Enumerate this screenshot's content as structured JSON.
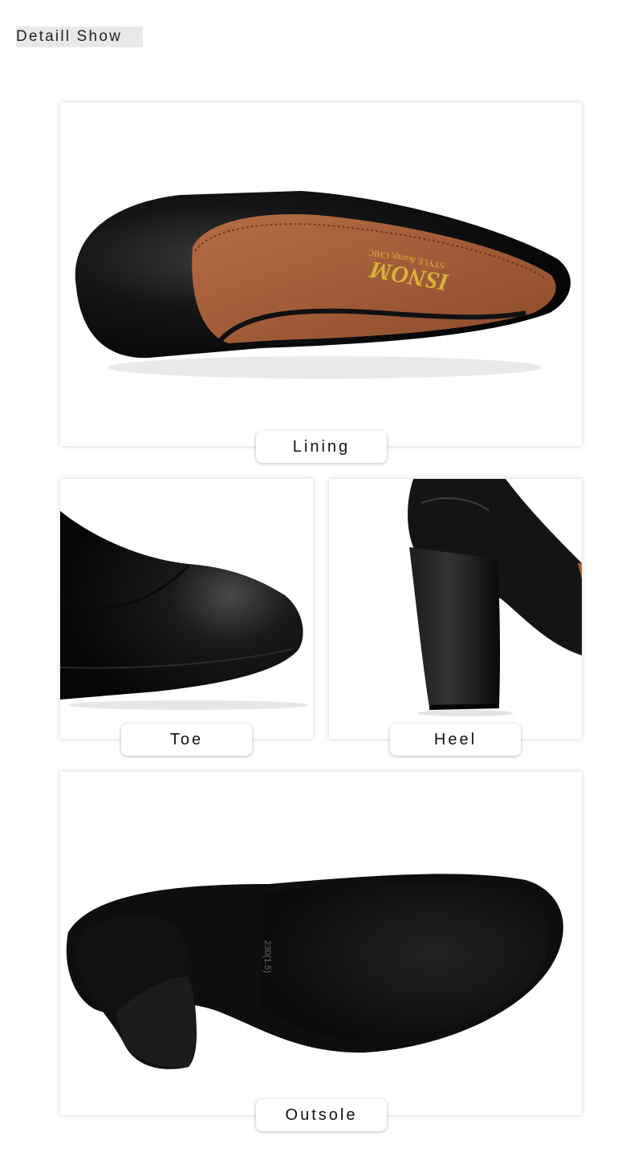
{
  "header": {
    "title": "Detaill Show"
  },
  "sections": {
    "lining": {
      "label": "Lining",
      "logo_text": "ISNOM",
      "logo_sub": "STYLE &amp; CHIC"
    },
    "toe": {
      "label": "Toe"
    },
    "heel": {
      "label": "Heel"
    },
    "outsole": {
      "label": "Outsole",
      "size_mark": "230(1.5)"
    }
  },
  "colors": {
    "leather_black": "#141414",
    "lining_brown": "#a5603a",
    "logo_gold": "#d8b23a",
    "caption_bg": "#ffffff"
  }
}
